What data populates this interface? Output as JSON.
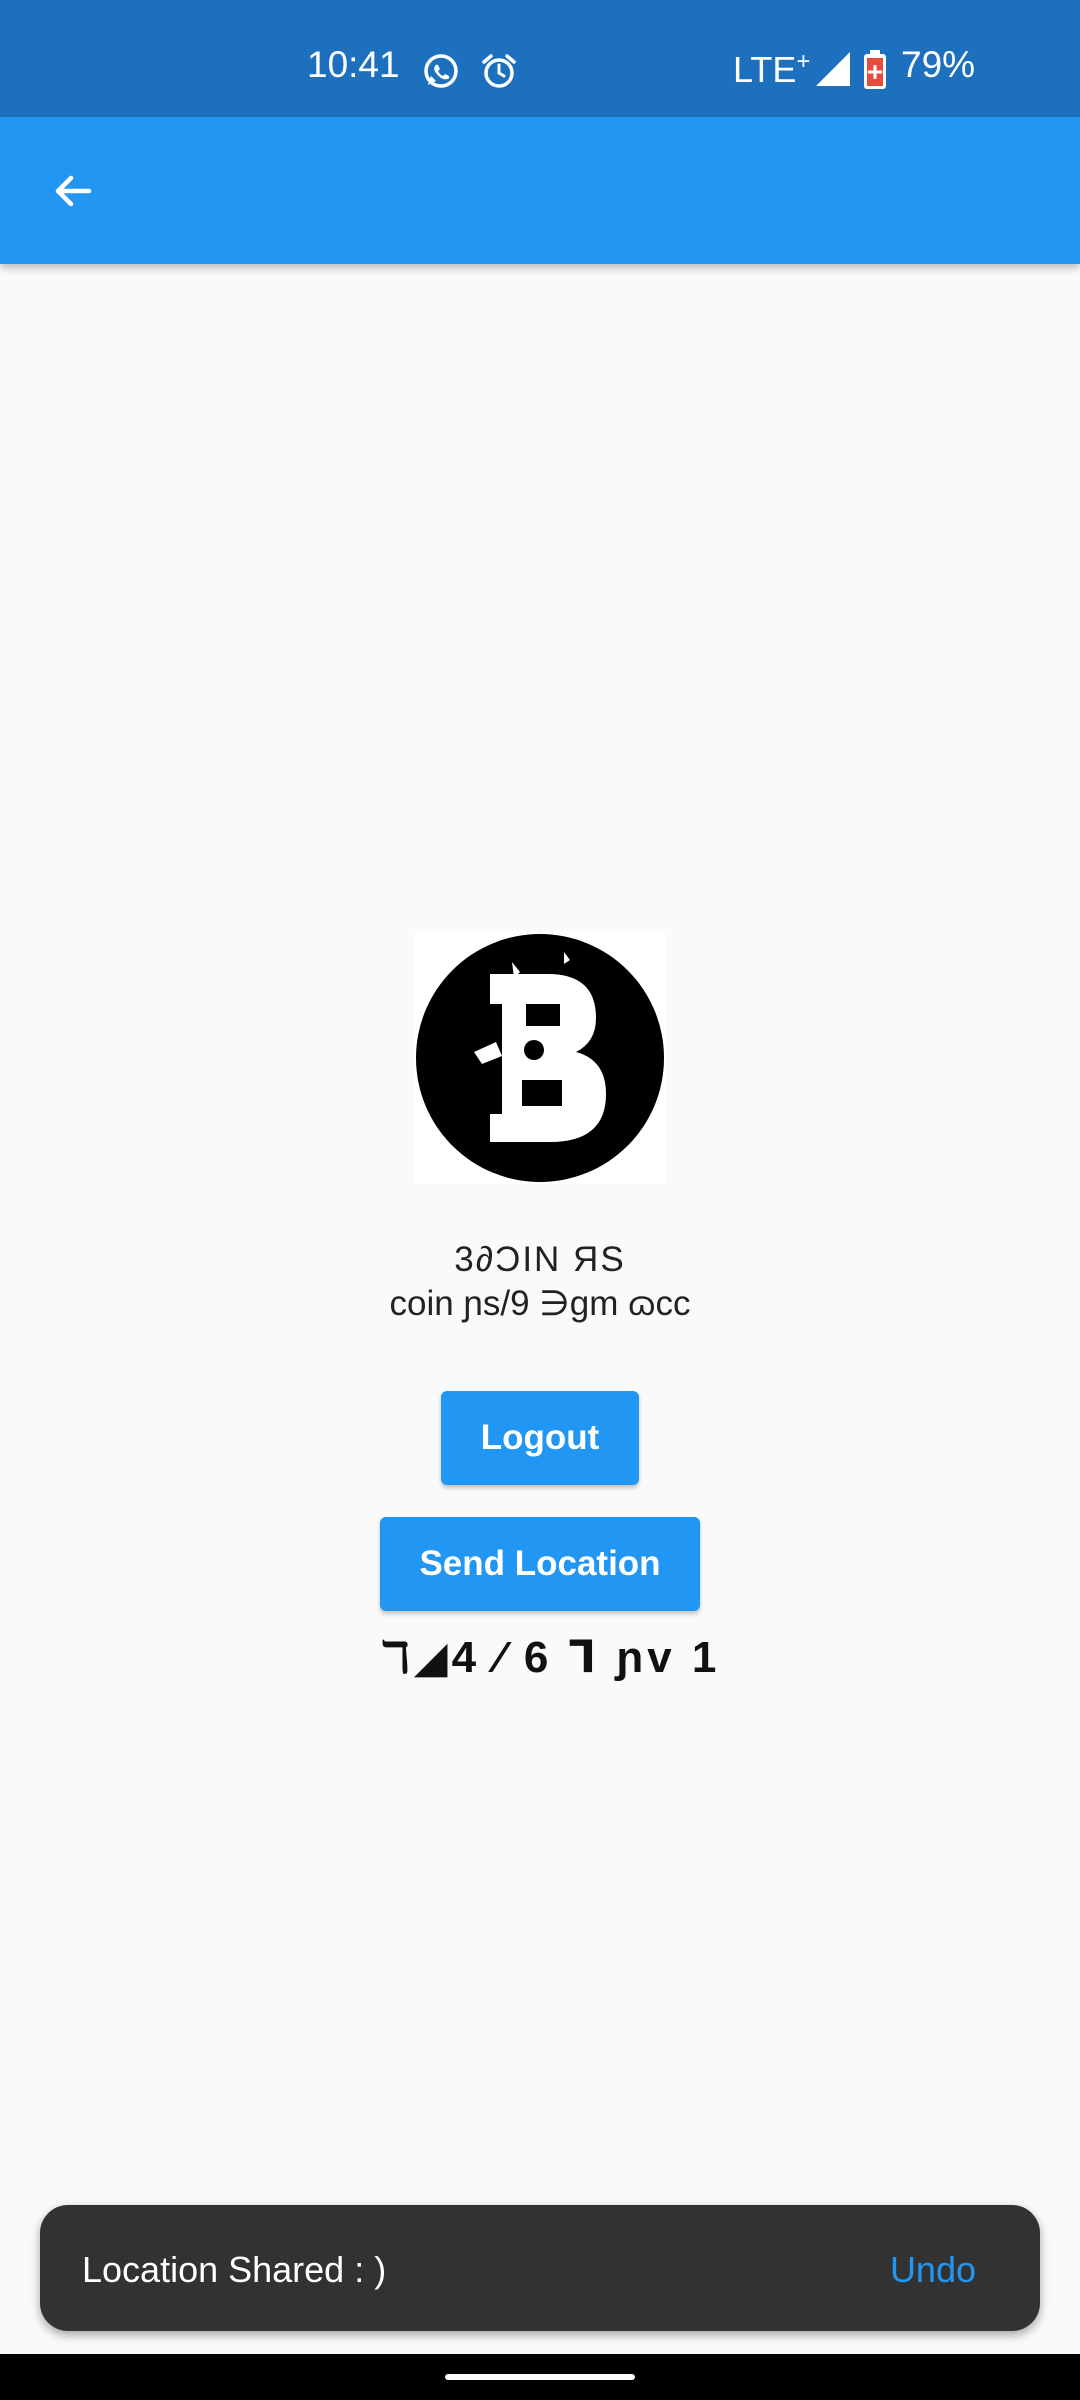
{
  "status_bar": {
    "time": "10:41",
    "network": "LTE",
    "network_suffix": "+",
    "battery": "79%",
    "icons": [
      "whatsapp-icon",
      "alarm-icon",
      "signal-icon",
      "battery-saver-icon"
    ]
  },
  "app_bar": {
    "back_icon": "arrow-back-icon",
    "color": "#2196f3"
  },
  "profile": {
    "name": "3∂ϽIN ЯS",
    "email": "coin ɲs/9 ∋gm ɷcc"
  },
  "buttons": {
    "logout": "Logout",
    "send_location": "Send Location"
  },
  "location_text": "ℸ◢4 ⁄ 6 ᒣ ɲv 1",
  "snackbar": {
    "message": "Location Shared : )",
    "action": "Undo"
  },
  "colors": {
    "status_bar": "#1c70bd",
    "primary": "#2196f3",
    "snackbar_bg": "#323232",
    "background": "#fafafa"
  }
}
